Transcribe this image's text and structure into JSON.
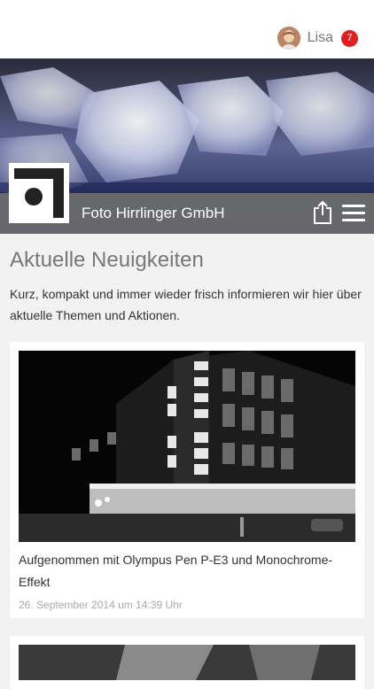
{
  "user": {
    "name": "Lisa",
    "notifications": "7"
  },
  "company": {
    "name": "Foto Hirrlinger GmbH"
  },
  "news": {
    "heading": "Aktuelle Neuigkeiten",
    "intro": "Kurz, kompakt und immer wieder frisch informieren wir hier über aktuelle Themen und Aktionen."
  },
  "posts": [
    {
      "title": "Aufgenommen mit Olympus Pen P-E3 und Monochrome-Effekt",
      "date": "26. September 2014 um 14:39 Uhr"
    }
  ],
  "colors": {
    "badge": "#e02020",
    "title_bar": "#6e6e6e",
    "page_bg": "#f2f2f2"
  },
  "icons": [
    "share-icon",
    "hamburger-menu-icon"
  ]
}
